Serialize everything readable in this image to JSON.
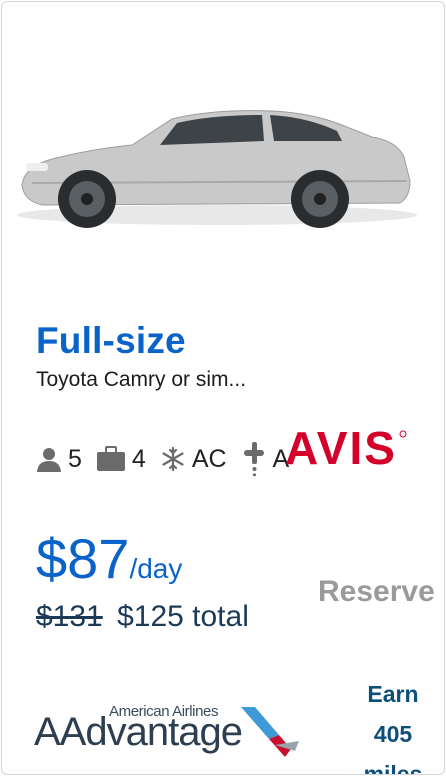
{
  "car": {
    "category": "Full-size",
    "model": "Toyota Camry or sim...",
    "image_icon": "sedan-car-photo"
  },
  "features": {
    "passengers": "5",
    "bags": "4",
    "ac": "AC",
    "transmission": "A"
  },
  "vendor": {
    "name": "AVIS",
    "brand_color": "#d4002a"
  },
  "pricing": {
    "daily_amount": "$87",
    "daily_unit": "/day",
    "original_total": "$131",
    "total": "$125 total"
  },
  "actions": {
    "reserve_label": "Reserve"
  },
  "loyalty": {
    "airline": "American Airlines",
    "program": "AAdvantage",
    "earn_label": "Earn",
    "miles_value": "405",
    "miles_unit": "miles"
  },
  "colors": {
    "accent": "#0a63c9",
    "reserve_disabled": "#9a9a9a",
    "miles": "#0b4f7a"
  }
}
